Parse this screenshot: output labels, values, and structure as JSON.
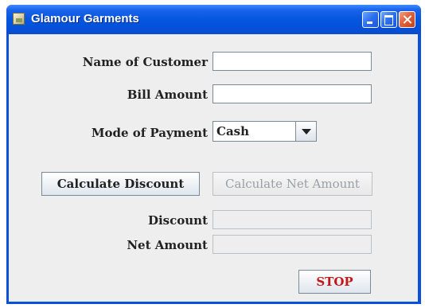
{
  "window": {
    "title": "Glamour Garments"
  },
  "form": {
    "customer_name_label": "Name of Customer",
    "customer_name_value": "",
    "bill_amount_label": "Bill Amount",
    "bill_amount_value": "",
    "payment_mode_label": "Mode of Payment",
    "payment_mode_selected": "Cash",
    "discount_label": "Discount",
    "discount_value": "",
    "net_amount_label": "Net Amount",
    "net_amount_value": ""
  },
  "buttons": {
    "calculate_discount": "Calculate Discount",
    "calculate_net_amount": "Calculate Net Amount",
    "stop": "STOP"
  },
  "colors": {
    "titlebar": "#0656e0",
    "stop_text": "#c41818",
    "panel_bg": "#eeeeee"
  }
}
